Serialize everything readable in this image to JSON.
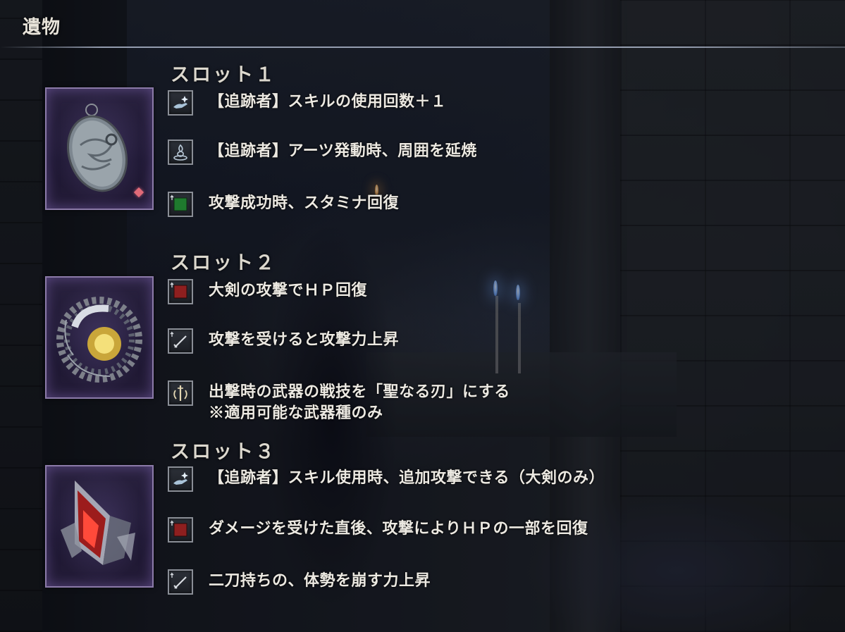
{
  "header": {
    "title": "遺物"
  },
  "colors": {
    "frame_border": "#8b7aa8",
    "text": "#ece9e2",
    "red_square": "#8e1f1f",
    "green_square": "#1f7a2e",
    "line": "#aab4c8"
  },
  "slots": [
    {
      "title": "スロット１",
      "relic_icon": "pendant-relic-icon",
      "effects": [
        {
          "icon": "skill-hand-icon",
          "text": "【追跡者】スキルの使用回数＋１"
        },
        {
          "icon": "flame-arts-icon",
          "text": "【追跡者】アーツ発動時、周囲を延焼"
        },
        {
          "icon": "green-stamina-icon",
          "text": "攻撃成功時、スタミナ回復"
        }
      ]
    },
    {
      "title": "スロット２",
      "relic_icon": "nest-relic-icon",
      "effects": [
        {
          "icon": "red-hp-icon",
          "text": "大剣の攻撃でＨＰ回復"
        },
        {
          "icon": "sword-attack-icon",
          "text": "攻撃を受けると攻撃力上昇"
        },
        {
          "icon": "sacred-blade-icon",
          "text": "出撃時の武器の戦技を「聖なる刃」にする",
          "note": "※適用可能な武器種のみ"
        }
      ]
    },
    {
      "title": "スロット３",
      "relic_icon": "crystal-relic-icon",
      "effects": [
        {
          "icon": "skill-hand-icon",
          "text": "【追跡者】スキル使用時、追加攻撃できる（大剣のみ）"
        },
        {
          "icon": "red-hp-icon",
          "text": "ダメージを受けた直後、攻撃によりＨＰの一部を回復"
        },
        {
          "icon": "sword-attack-icon",
          "text": "二刀持ちの、体勢を崩す力上昇"
        }
      ]
    }
  ]
}
